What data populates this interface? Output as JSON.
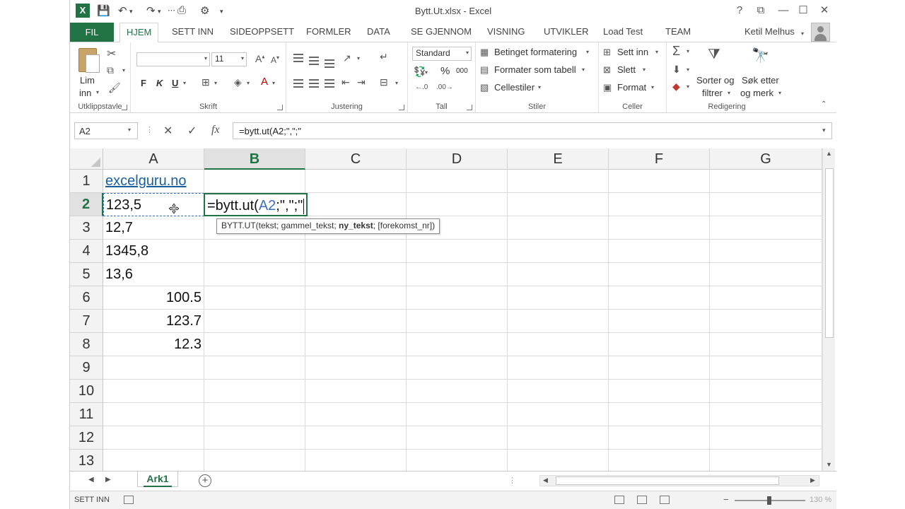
{
  "app": {
    "title": "Bytt.Ut.xlsx - Excel",
    "user": "Ketil Melhus"
  },
  "tabs": [
    "FIL",
    "HJEM",
    "SETT INN",
    "SIDEOPPSETT",
    "FORMLER",
    "DATA",
    "SE GJENNOM",
    "VISNING",
    "UTVIKLER",
    "Load Test",
    "TEAM"
  ],
  "ribbon": {
    "clipboard": {
      "paste_line1": "Lim",
      "paste_line2": "inn",
      "group": "Utklippstavle"
    },
    "font": {
      "size": "11",
      "bold": "F",
      "italic": "K",
      "underline": "U",
      "group": "Skrift"
    },
    "alignment": {
      "group": "Justering"
    },
    "number": {
      "format": "Standard",
      "percent": "%",
      "thousands": "000",
      "group": "Tall"
    },
    "styles": {
      "conditional": "Betinget formatering",
      "as_table": "Formater som tabell",
      "cell_styles": "Cellestiler",
      "group": "Stiler"
    },
    "cells": {
      "insert": "Sett inn",
      "delete": "Slett",
      "format": "Format",
      "group": "Celler"
    },
    "editing": {
      "sort_line1": "Sorter og",
      "sort_line2": "filtrer",
      "find_line1": "Søk etter",
      "find_line2": "og merk",
      "group": "Redigering"
    }
  },
  "formula_bar": {
    "name_box": "A2",
    "formula": "=bytt.ut(A2;\",\";\""
  },
  "grid": {
    "columns": [
      "A",
      "B",
      "C",
      "D",
      "E",
      "F",
      "G"
    ],
    "active_column": "B",
    "rows": [
      "1",
      "2",
      "3",
      "4",
      "5",
      "6",
      "7",
      "8",
      "9",
      "10",
      "11",
      "12",
      "13"
    ],
    "active_row": "2",
    "cells": {
      "A1": "excelguru.no",
      "A2": "123,5",
      "A3": "12,7",
      "A4": "1345,8",
      "A5": "13,6",
      "A6": "100.5",
      "A7": "123.7",
      "A8": "12.3"
    },
    "editing": {
      "prefix": "=bytt.ut(",
      "ref": "A2",
      "suffix": ";\",\";\""
    },
    "tooltip": {
      "pre": "BYTT.UT(tekst; gammel_tekst; ",
      "bold": "ny_tekst",
      "post": "; [forekomst_nr])"
    }
  },
  "sheets": {
    "active": "Ark1"
  },
  "status": {
    "mode": "SETT INN",
    "zoom": "130 %"
  },
  "colors": {
    "excel_green": "#217346",
    "reference_blue": "#3b6fc4",
    "link_blue": "#1a5f9c"
  }
}
